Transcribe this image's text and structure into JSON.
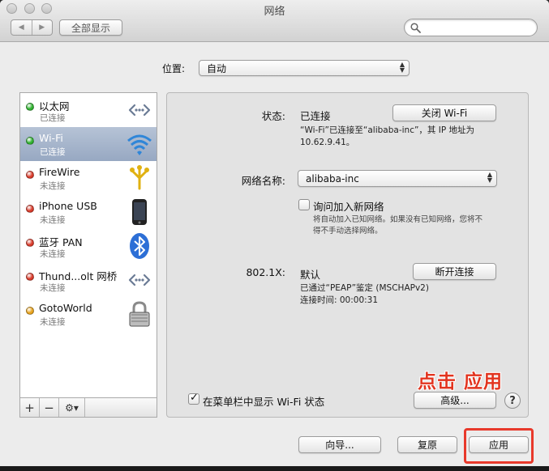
{
  "window": {
    "title": "网络",
    "show_all_label": "全部显示",
    "search_placeholder": ""
  },
  "location": {
    "label": "位置:",
    "value": "自动"
  },
  "sidebar": {
    "items": [
      {
        "name": "以太网",
        "status": "已连接",
        "dot_color": "#2fb12f",
        "icon": "ethernet-icon"
      },
      {
        "name": "Wi-Fi",
        "status": "已连接",
        "dot_color": "#2fb12f",
        "icon": "wifi-icon"
      },
      {
        "name": "FireWire",
        "status": "未连接",
        "dot_color": "#d83a2a",
        "icon": "firewire-icon"
      },
      {
        "name": "iPhone USB",
        "status": "未连接",
        "dot_color": "#d83a2a",
        "icon": "iphone-icon"
      },
      {
        "name": "蓝牙 PAN",
        "status": "未连接",
        "dot_color": "#d83a2a",
        "icon": "bluetooth-icon"
      },
      {
        "name": "Thund...olt 网桥",
        "status": "未连接",
        "dot_color": "#d83a2a",
        "icon": "thunderbolt-bridge-icon"
      },
      {
        "name": "GotoWorld",
        "status": "未连接",
        "dot_color": "#e7a21c",
        "icon": "lock-icon"
      }
    ],
    "tools": {
      "add": "+",
      "remove": "−",
      "action": "⚙▾"
    }
  },
  "detail": {
    "status_label": "状态:",
    "status_value": "已连接",
    "turn_off_wifi_button": "关闭 Wi-Fi",
    "status_desc_line1": "“Wi-Fi”已连接至“alibaba-inc”，其 IP 地址为",
    "status_desc_line2": "10.62.9.41。",
    "network_name_label": "网络名称:",
    "network_name_value": "alibaba-inc",
    "ask_join_label": "询问加入新网络",
    "ask_join_desc_line1": "将自动加入已知网络。如果没有已知网络，您将不",
    "ask_join_desc_line2": "得不手动选择网络。",
    "auth_label": "802.1X:",
    "auth_value": "默认",
    "disconnect_button": "断开连接",
    "auth_desc_line1": "已通过“PEAP”鉴定 (MSCHAPv2)",
    "auth_desc_line2": "连接时间:  00:00:31",
    "menubar_checkbox_label": "在菜单栏中显示 Wi-Fi 状态",
    "advanced_button": "高级...",
    "help_button": "?"
  },
  "footer": {
    "assistant_button": "向导...",
    "revert_button": "复原",
    "apply_button": "应用"
  },
  "annotation": {
    "text": "点击 应用",
    "color": "#e2341f"
  }
}
